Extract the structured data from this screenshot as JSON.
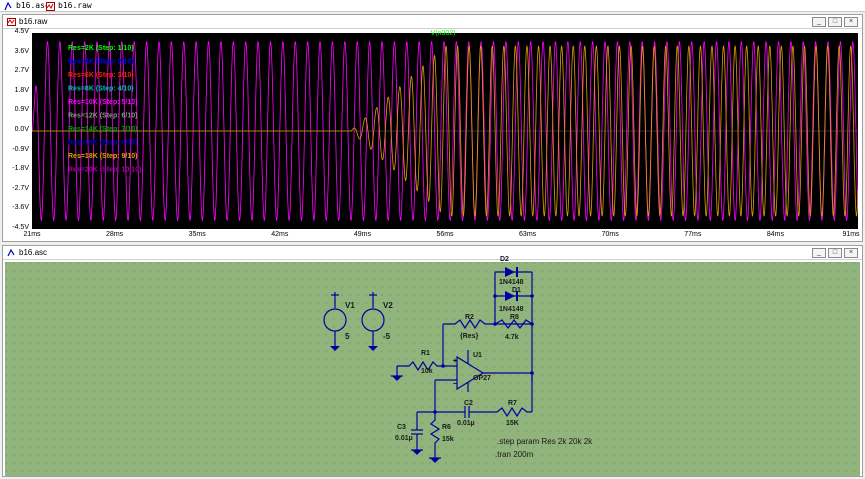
{
  "tabs": [
    {
      "label": "b16.asc"
    },
    {
      "label": "b16.raw"
    }
  ],
  "plot_window": {
    "title": "b16.raw",
    "trace_name": "V(n002)",
    "buttons": [
      "_",
      "□",
      "×"
    ]
  },
  "schematic_window": {
    "title": "b16.asc",
    "buttons": [
      "_",
      "□",
      "×"
    ]
  },
  "chart_data": {
    "type": "line",
    "title": "V(n002)",
    "xlabel": "",
    "ylabel": "",
    "ylim": [
      -4.5,
      4.5
    ],
    "xlim": [
      21,
      91
    ],
    "y_ticks": [
      "4.5V",
      "3.6V",
      "2.7V",
      "1.8V",
      "0.9V",
      "0.0V",
      "-0.9V",
      "-1.8V",
      "-2.7V",
      "-3.6V",
      "-4.5V"
    ],
    "x_ticks": [
      "21ms",
      "28ms",
      "35ms",
      "42ms",
      "49ms",
      "56ms",
      "63ms",
      "70ms",
      "77ms",
      "84ms",
      "91ms"
    ],
    "grid": false,
    "legend_position": "top-left",
    "series": [
      {
        "name": "Res=2K  (Step: 1/10)",
        "color": "#00ff00"
      },
      {
        "name": "Res=4K  (Step: 2/10)",
        "color": "#0000ff"
      },
      {
        "name": "Res=6K  (Step: 3/10)",
        "color": "#ff2000"
      },
      {
        "name": "Res=8K  (Step: 4/10)",
        "color": "#00c0c0"
      },
      {
        "name": "Res=10K  (Step: 5/10)",
        "color": "#ff00ff"
      },
      {
        "name": "Res=12K  (Step: 6/10)",
        "color": "#909090"
      },
      {
        "name": "Res=14K  (Step: 7/10)",
        "color": "#00a000"
      },
      {
        "name": "Res=16K  (Step: 8/10)",
        "color": "#0000c0"
      },
      {
        "name": "Res=18K  (Step: 9/10)",
        "color": "#e0a000"
      },
      {
        "name": "Res=20K  (Step: 10/10)",
        "color": "#a000a0"
      }
    ],
    "oscillations": [
      {
        "series": "Res=10K  (Step: 5/10)",
        "amplitude": 4.1,
        "start_ms": 21,
        "period_ms": 1.05
      },
      {
        "series": "Res=18K  (Step: 9/10)",
        "amplitude": 3.9,
        "start_ms": 48,
        "period_ms": 0.98
      }
    ]
  },
  "schematic": {
    "labels": {
      "V1": "V1",
      "V1_val": "5",
      "V2": "V2",
      "V2_val": "-5",
      "D2": "D2",
      "D2_model": "1N4148",
      "D1": "D1",
      "D1_model": "1N4148",
      "R2": "R2",
      "R2_val": "{Res}",
      "R8": "R8",
      "R8_val": "4.7k",
      "R1": "R1",
      "R1_val": "10k",
      "U1": "U1",
      "U1_model": "OP27",
      "C2": "C2",
      "C2_val": "0.01µ",
      "R7": "R7",
      "R7_val": "15K",
      "C3": "C3",
      "C3_val": "0.01µ",
      "R6": "R6",
      "R6_val": "15k"
    },
    "directives": [
      ".step param Res 2k 20k 2k",
      ".tran 200m"
    ]
  },
  "colors": {
    "plot_bg": "#000000",
    "schematic_bg": "#90b47c",
    "wire": "#0000a0",
    "trace_title": "#00ff00"
  }
}
